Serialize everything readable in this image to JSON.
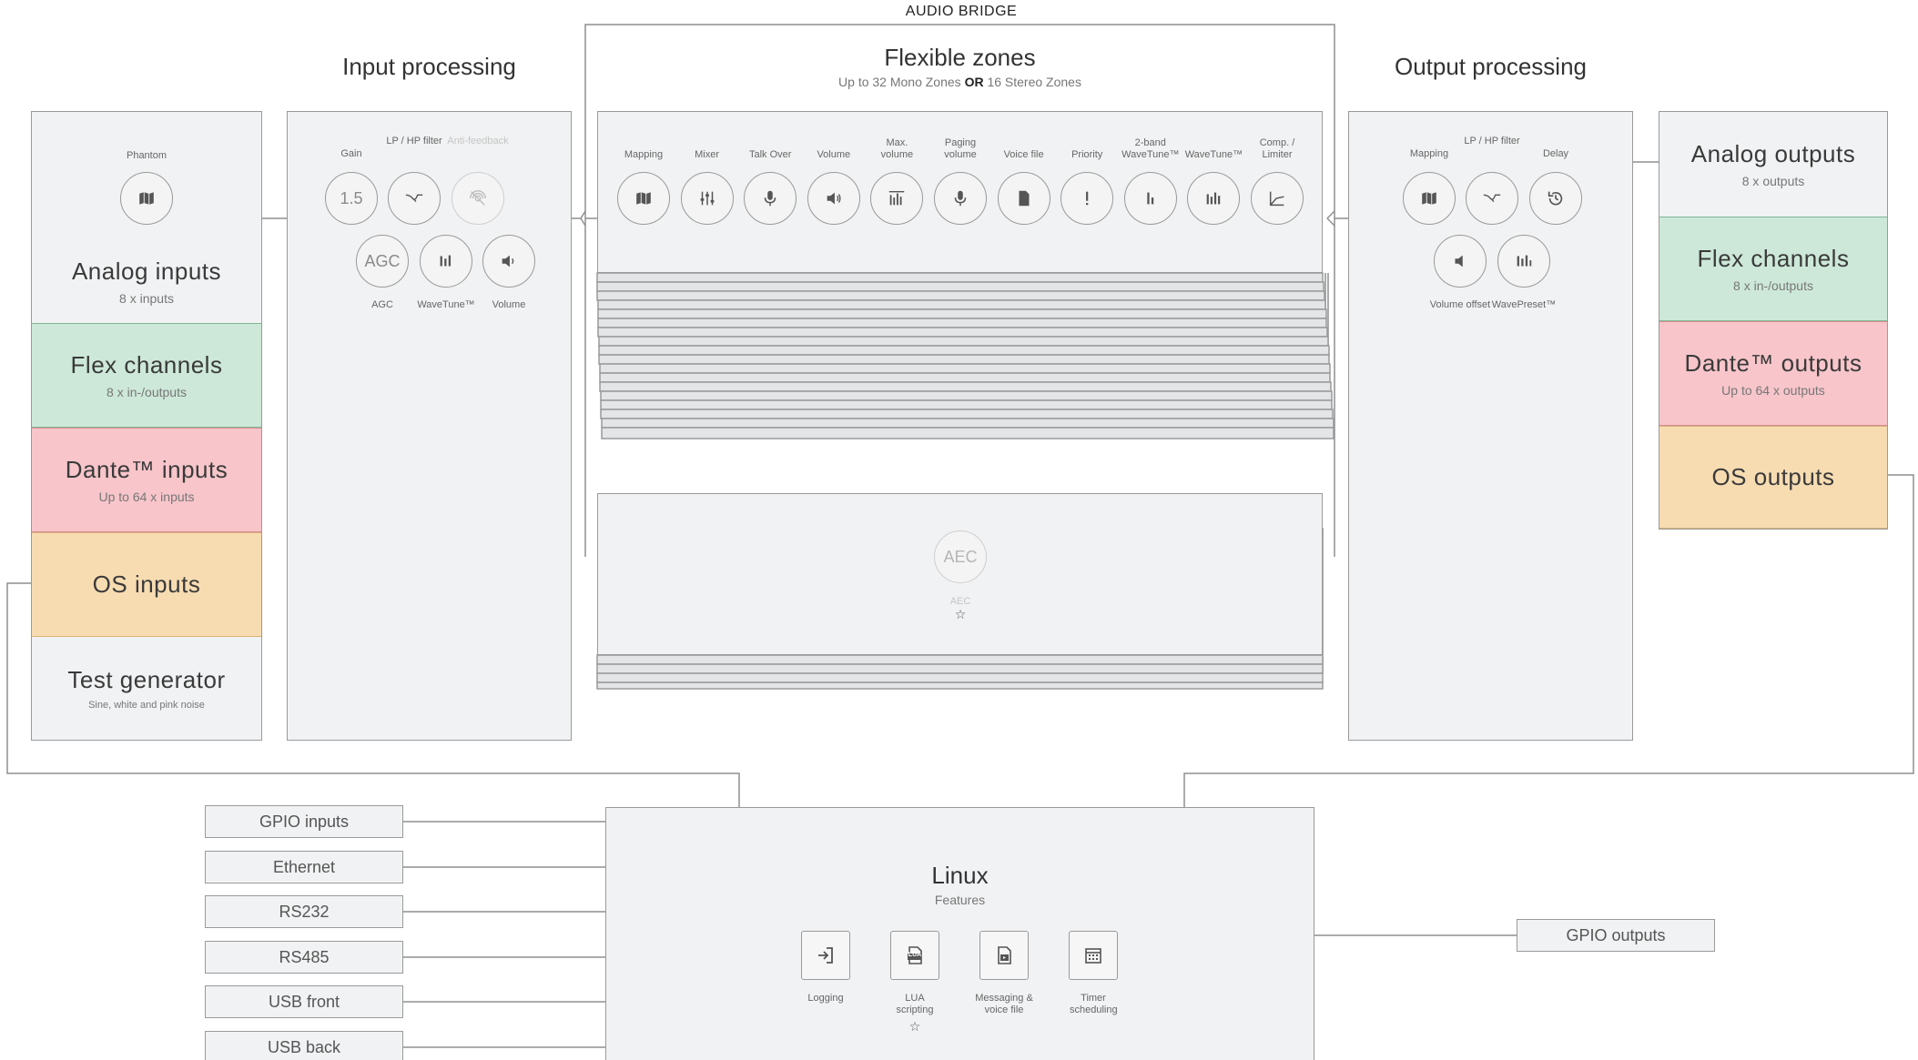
{
  "audio_bridge": {
    "label": "AUDIO BRIDGE"
  },
  "inputs": {
    "phantom_label": "Phantom",
    "blocks": [
      {
        "title": "Analog inputs",
        "subtitle": "8 x inputs"
      },
      {
        "title": "Flex channels",
        "subtitle": "8 x in-/outputs"
      },
      {
        "title": "Dante™ inputs",
        "subtitle": "Up to 64 x inputs"
      },
      {
        "title": "OS inputs",
        "subtitle": ""
      },
      {
        "title": "Test generator",
        "subtitle": "Sine, white and pink noise"
      }
    ]
  },
  "input_processing": {
    "title": "Input processing",
    "top_labels": [
      "Gain",
      "LP / HP filter",
      "Anti-feedback"
    ],
    "bottom_labels": [
      "AGC",
      "WaveTune™",
      "Volume"
    ],
    "gain_value": "1.5",
    "agc_text": "AGC"
  },
  "flexible_zones": {
    "title": "Flexible zones",
    "subtitle_a": "Up to 32 Mono Zones",
    "subtitle_or": "OR",
    "subtitle_b": "16 Stereo Zones",
    "chain_labels": [
      "Mapping",
      "Mixer",
      "Talk Over",
      "Volume",
      "Max. volume",
      "Paging volume",
      "Voice file",
      "Priority",
      "2-band WaveTune™",
      "WaveTune™",
      "Comp. / Limiter"
    ],
    "aec_text": "AEC",
    "aec_label": "AEC",
    "star": "☆"
  },
  "output_processing": {
    "title": "Output processing",
    "top_labels": [
      "Mapping",
      "LP / HP filter",
      "Delay"
    ],
    "bottom_labels": [
      "Volume offset",
      "WavePreset™"
    ]
  },
  "outputs": {
    "blocks": [
      {
        "title": "Analog outputs",
        "subtitle": "8 x outputs"
      },
      {
        "title": "Flex channels",
        "subtitle": "8 x in-/outputs"
      },
      {
        "title": "Dante™ outputs",
        "subtitle": "Up to 64 x outputs"
      },
      {
        "title": "OS outputs",
        "subtitle": ""
      }
    ]
  },
  "linux": {
    "title": "Linux",
    "subtitle": "Features",
    "features": [
      "Logging",
      "LUA scripting",
      "Messaging & voice file",
      "Timer scheduling"
    ],
    "lua_badge": "LUA",
    "star": "☆"
  },
  "interfaces": {
    "left": [
      "GPIO inputs",
      "Ethernet",
      "RS232",
      "RS485",
      "USB front",
      "USB back"
    ],
    "right": [
      "GPIO outputs"
    ]
  },
  "colors": {
    "green": "#cde8d8",
    "red": "#f7c5ca",
    "orange": "#f7dcb2",
    "panel": "#f1f2f3",
    "stroke": "#9a9a9a"
  }
}
